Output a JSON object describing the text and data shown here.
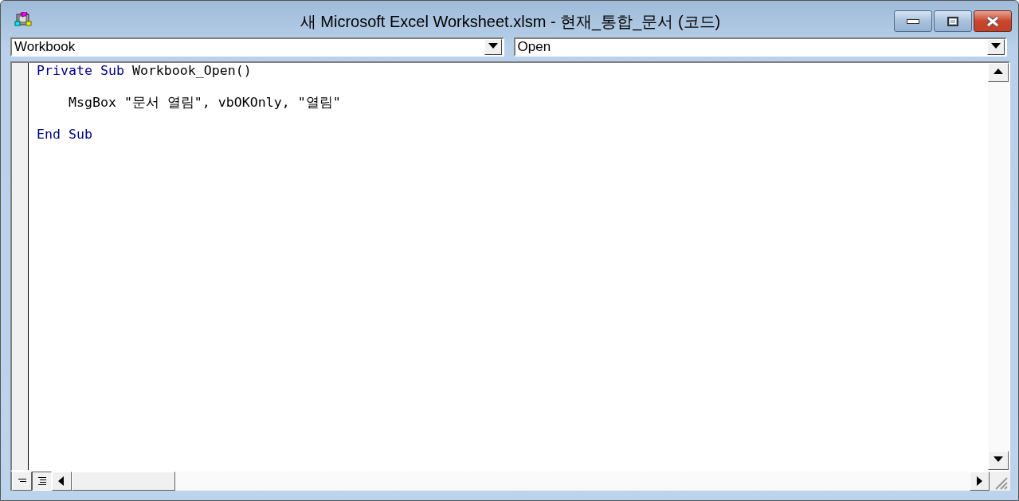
{
  "window": {
    "title": "새 Microsoft Excel Worksheet.xlsm - 현재_통합_문서 (코드)"
  },
  "object_box": {
    "value": "Workbook"
  },
  "procedure_box": {
    "value": "Open"
  },
  "code_lines": [
    {
      "tokens": [
        {
          "text": "Private",
          "kind": "keyword"
        },
        {
          "text": " Sub",
          "kind": "keyword"
        },
        {
          "text": " Workbook_Open()",
          "kind": "plain"
        }
      ]
    },
    {
      "tokens": [
        {
          "text": "    MsgBox \"문서 열림\", vbOKOnly, \"열림\"",
          "kind": "plain"
        }
      ]
    },
    {
      "tokens": [
        {
          "text": "End",
          "kind": "keyword"
        },
        {
          "text": " Sub",
          "kind": "keyword"
        }
      ]
    }
  ],
  "view_buttons": [
    {
      "selected": false
    },
    {
      "selected": true
    }
  ]
}
